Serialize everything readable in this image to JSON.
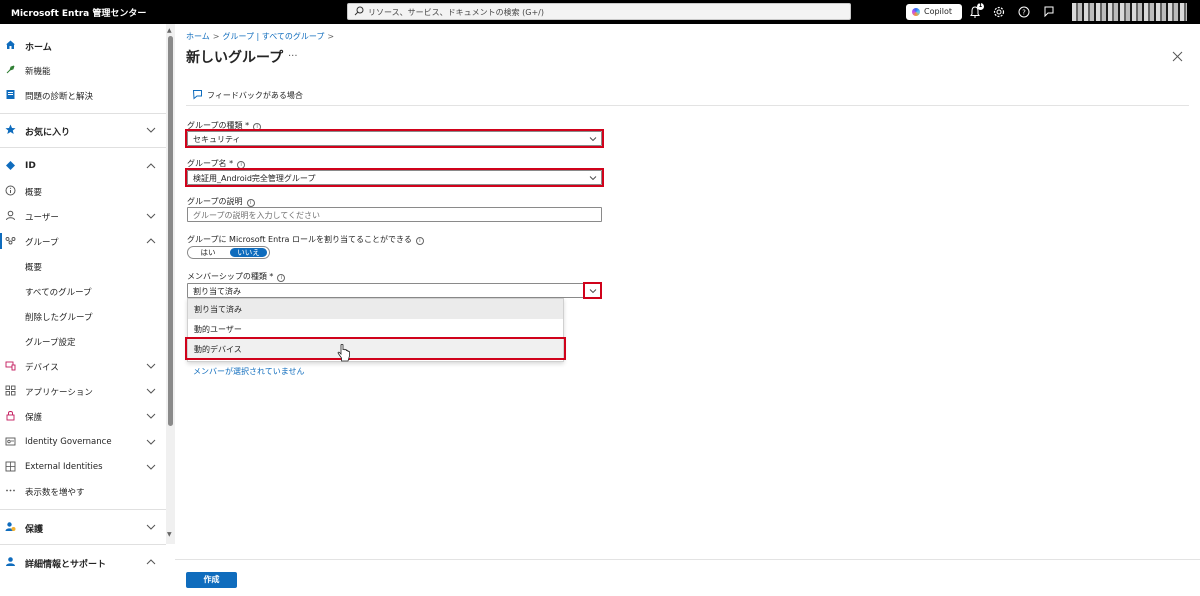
{
  "app": {
    "title": "Microsoft Entra 管理センター"
  },
  "search": {
    "placeholder": "リソース、サービス、ドキュメントの検索 (G+/)"
  },
  "topbar": {
    "copilot_label": "Copilot",
    "notification_count": "1"
  },
  "sidebar": {
    "items": [
      {
        "label": "ホーム",
        "icon": "home-icon"
      },
      {
        "label": "新機能",
        "icon": "rocket-icon"
      },
      {
        "label": "問題の診断と解決",
        "icon": "diagnose-icon"
      },
      {
        "label": "お気に入り",
        "icon": "star-icon"
      },
      {
        "label": "ID",
        "icon": "id-diamond-icon"
      },
      {
        "label": "概要",
        "icon": "info-icon"
      },
      {
        "label": "ユーザー",
        "icon": "user-icon"
      },
      {
        "label": "グループ",
        "icon": "groups-icon"
      },
      {
        "label": "概要"
      },
      {
        "label": "すべてのグループ"
      },
      {
        "label": "削除したグループ"
      },
      {
        "label": "グループ設定"
      },
      {
        "label": "デバイス",
        "icon": "devices-icon"
      },
      {
        "label": "アプリケーション",
        "icon": "apps-grid-icon"
      },
      {
        "label": "保護",
        "icon": "lock-icon"
      },
      {
        "label": "Identity Governance",
        "icon": "governance-icon"
      },
      {
        "label": "External Identities",
        "icon": "external-icon"
      },
      {
        "label": "表示数を増やす",
        "icon": "more-icon"
      },
      {
        "label": "保護",
        "icon": "protect-user-icon"
      },
      {
        "label": "詳細情報とサポート",
        "icon": "support-icon"
      }
    ],
    "collapse_glyph": "«"
  },
  "main": {
    "breadcrumb": [
      "ホーム",
      "グループ | すべてのグループ"
    ],
    "title": "新しいグループ",
    "feedback_label": "フィードバックがある場合",
    "group_type": {
      "label": "グループの種類",
      "value": "セキュリティ"
    },
    "group_name": {
      "label": "グループ名",
      "value": "検証用_Android完全管理グループ"
    },
    "group_description": {
      "label": "グループの説明",
      "placeholder": "グループの説明を入力してください"
    },
    "role_assignable": {
      "label": "グループに Microsoft Entra ロールを割り当てることができる",
      "yes": "はい",
      "no": "いいえ",
      "selected": "いいえ"
    },
    "membership_type": {
      "label": "メンバーシップの種類",
      "value": "割り当て済み",
      "options": [
        "割り当て済み",
        "動的ユーザー",
        "動的デバイス"
      ]
    },
    "members_link": "メンバーが選択されていません",
    "create_button": "作成"
  },
  "colors": {
    "accent": "#0f6cbd",
    "highlight": "#d0021b",
    "topbar": "#000000"
  }
}
